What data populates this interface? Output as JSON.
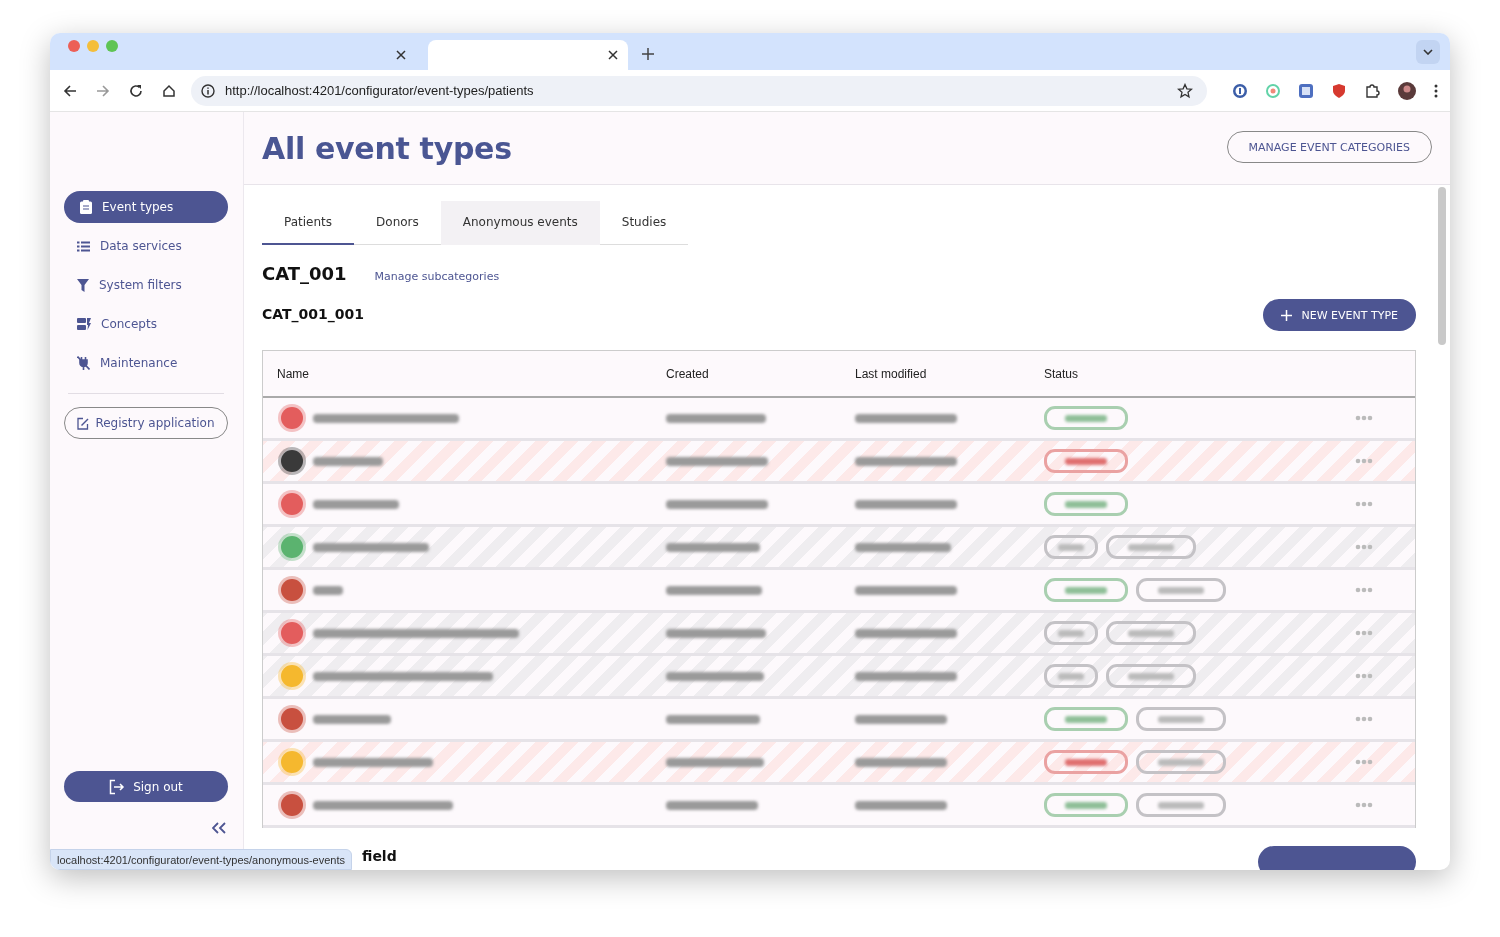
{
  "browser": {
    "tabs": [
      {
        "selected": false
      },
      {
        "selected": true
      }
    ],
    "url": "http://localhost:4201/configurator/event-types/patients",
    "status_url": "localhost:4201/configurator/event-types/anonymous-events"
  },
  "sidebar": {
    "items": [
      {
        "label": "Event types",
        "selected": true
      },
      {
        "label": "Data services",
        "selected": false
      },
      {
        "label": "System filters",
        "selected": false
      },
      {
        "label": "Concepts",
        "selected": false
      },
      {
        "label": "Maintenance",
        "selected": false
      }
    ],
    "registry_button": "Registry application",
    "sign_out": "Sign out"
  },
  "header": {
    "title": "All event types",
    "manage_button": "MANAGE EVENT CATEGORIES"
  },
  "tabs": [
    {
      "label": "Patients",
      "selected": true,
      "hovered": false
    },
    {
      "label": "Donors",
      "selected": false,
      "hovered": false
    },
    {
      "label": "Anonymous events",
      "selected": false,
      "hovered": true
    },
    {
      "label": "Studies",
      "selected": false,
      "hovered": false
    }
  ],
  "category": {
    "title": "CAT_001",
    "link": "Manage subcategories"
  },
  "subcategory": {
    "title": "CAT_001_001",
    "new_button": "NEW EVENT TYPE"
  },
  "table": {
    "columns": [
      "Name",
      "Created",
      "Last modified",
      "Status"
    ],
    "rows": [
      {
        "color": "#e35d5d",
        "kind": "published",
        "extra_chip": false
      },
      {
        "color": "#3a3a3a",
        "kind": "unpublished",
        "extra_chip": false
      },
      {
        "color": "#e35d5d",
        "kind": "published",
        "extra_chip": false
      },
      {
        "color": "#5bb36f",
        "kind": "draft",
        "extra_chip": true
      },
      {
        "color": "#c8503f",
        "kind": "published",
        "extra_chip": true
      },
      {
        "color": "#e35d5d",
        "kind": "draft",
        "extra_chip": true
      },
      {
        "color": "#f5b82e",
        "kind": "draft",
        "extra_chip": true
      },
      {
        "color": "#c8503f",
        "kind": "published",
        "extra_chip": true
      },
      {
        "color": "#f5b82e",
        "kind": "unpublished",
        "extra_chip": true
      },
      {
        "color": "#c8503f",
        "kind": "published",
        "extra_chip": true
      }
    ]
  },
  "next_section": {
    "title": "field"
  }
}
